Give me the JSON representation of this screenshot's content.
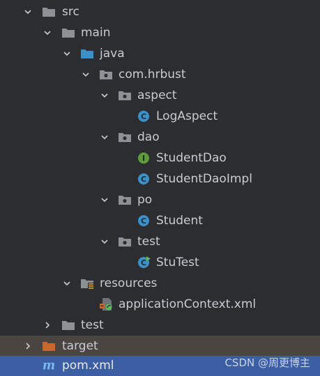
{
  "tree": {
    "src": "src",
    "main": "main",
    "java": "java",
    "package": "com.hrbust",
    "aspect": "aspect",
    "log_aspect": "LogAspect",
    "dao": "dao",
    "student_dao": "StudentDao",
    "student_dao_impl": "StudentDaoImpl",
    "po": "po",
    "student": "Student",
    "test_pkg": "test",
    "stu_test": "StuTest",
    "resources": "resources",
    "app_context": "applicationContext.xml",
    "test_dir": "test",
    "target": "target",
    "pom": "pom.xml"
  },
  "watermark": "CSDN @周更博主",
  "icons": {
    "class_badge": "C",
    "interface_badge": "I",
    "maven_mark": "m"
  },
  "colors": {
    "background": "#2b2d30",
    "text": "#c9ccd1",
    "folder": "#8d9196",
    "source_folder": "#3d8fc7",
    "target_folder": "#c9682e",
    "class_icon": "#3d8fc7",
    "interface_icon": "#5e9b3c",
    "selection": "#3c5fa3",
    "target_row": "#4a4540"
  }
}
